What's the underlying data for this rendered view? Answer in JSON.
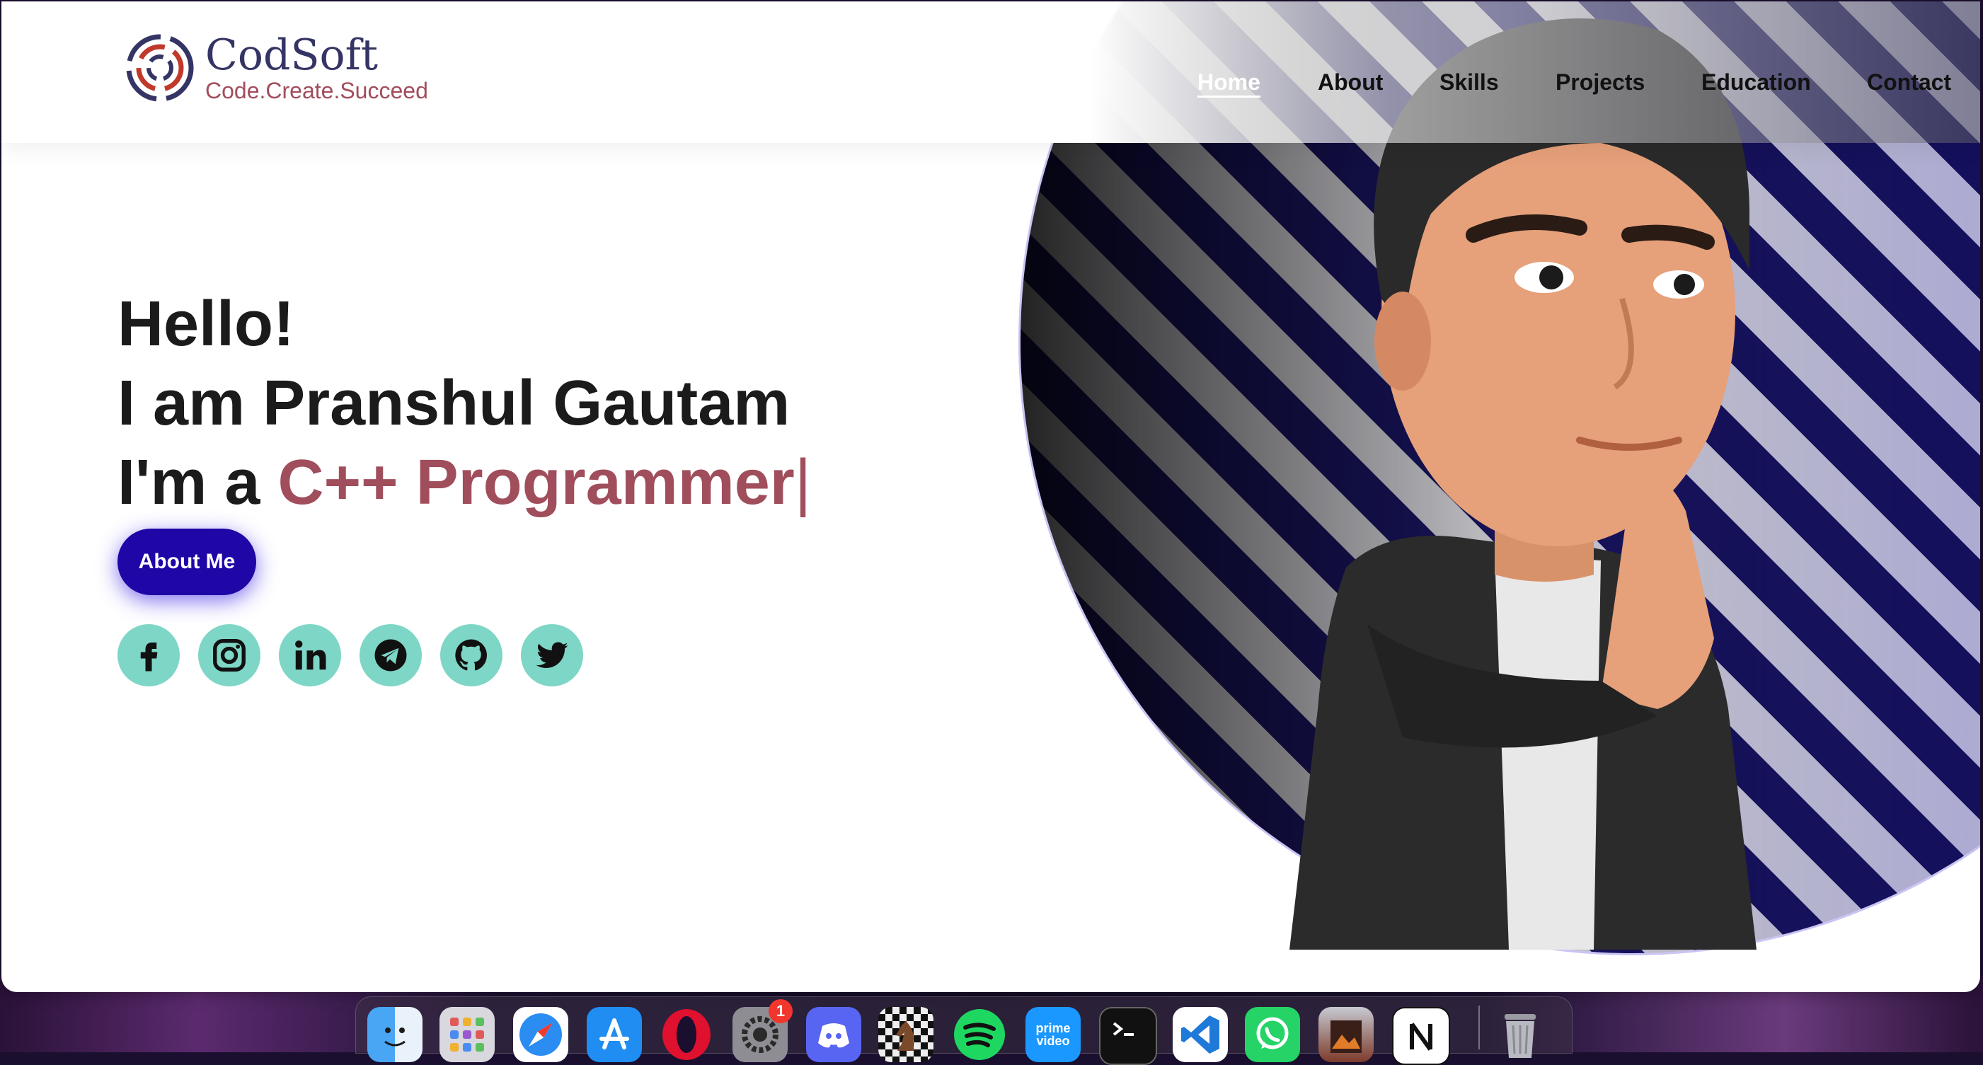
{
  "logo": {
    "name": "CodSoft",
    "tagline": "Code.Create.Succeed"
  },
  "nav": [
    {
      "label": "Home",
      "active": true
    },
    {
      "label": "About",
      "active": false
    },
    {
      "label": "Skills",
      "active": false
    },
    {
      "label": "Projects",
      "active": false
    },
    {
      "label": "Education",
      "active": false
    },
    {
      "label": "Contact",
      "active": false
    }
  ],
  "hero": {
    "greeting": "Hello!",
    "name_line": "I am Pranshul Gautam",
    "role_prefix": "I'm a ",
    "role": "C++ Programmer",
    "cursor": "|",
    "button_label": "About Me"
  },
  "socials": [
    "facebook-icon",
    "instagram-icon",
    "linkedin-icon",
    "telegram-icon",
    "github-icon",
    "twitter-icon"
  ],
  "colors": {
    "accent": "#a04e5c",
    "button": "#1f06a6",
    "social_bg": "#7ed6c6",
    "stripe": "#1a1566"
  },
  "dock": {
    "apps": [
      "Finder",
      "Launchpad",
      "Safari",
      "App Store",
      "Opera",
      "System Settings",
      "Discord",
      "Chess",
      "Spotify",
      "Prime Video",
      "Terminal",
      "Visual Studio Code",
      "WhatsApp",
      "Preview",
      "Notion",
      "Trash"
    ],
    "prime_label": "prime video",
    "settings_badge": "1"
  }
}
